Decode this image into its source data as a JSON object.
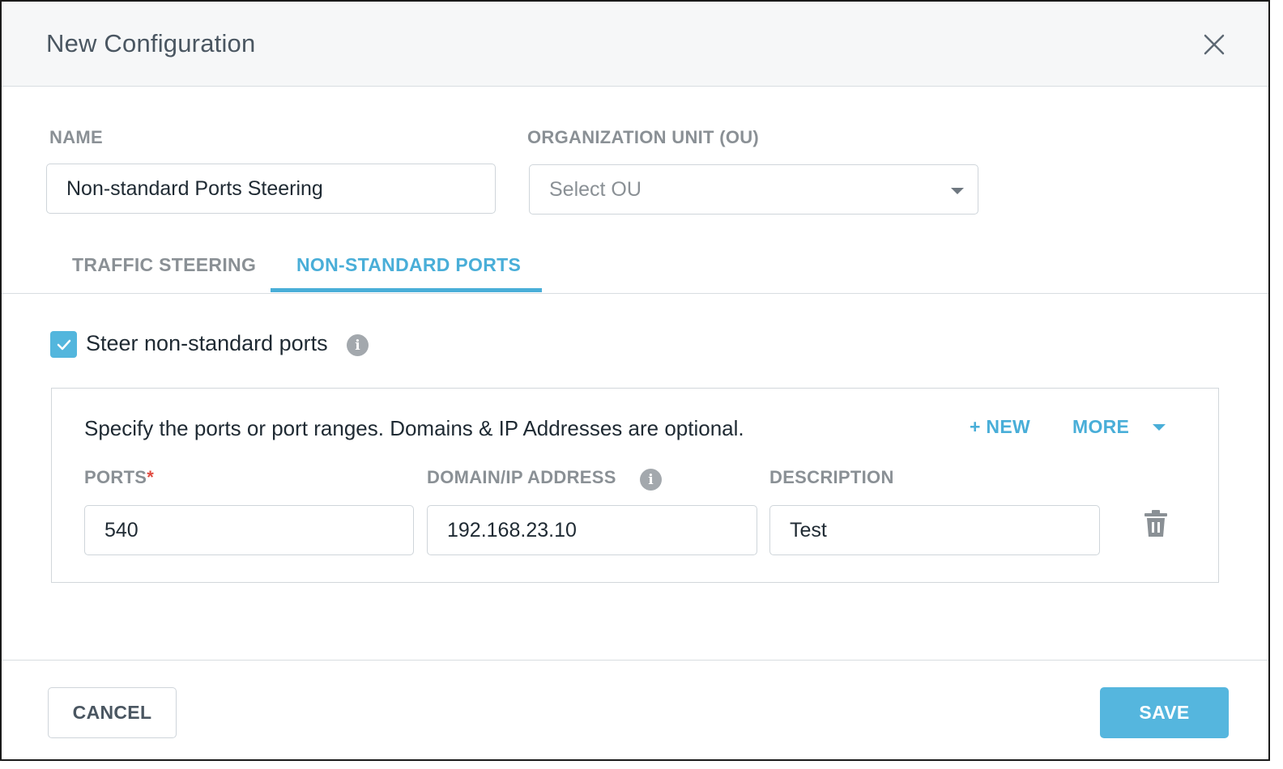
{
  "dialog": {
    "title": "New Configuration",
    "close_icon": "close-icon"
  },
  "form": {
    "name_label": "NAME",
    "name_value": "Non-standard Ports Steering",
    "ou_label": "ORGANIZATION UNIT (OU)",
    "ou_placeholder": "Select OU"
  },
  "tabs": [
    {
      "label": "TRAFFIC STEERING",
      "active": false
    },
    {
      "label": "NON-STANDARD PORTS",
      "active": true
    }
  ],
  "steer": {
    "checked": true,
    "label": "Steer non-standard ports",
    "info_icon": "info-icon"
  },
  "ports_panel": {
    "description": "Specify the ports or port ranges. Domains & IP Addresses are optional.",
    "new_label": "+ NEW",
    "more_label": "MORE",
    "columns": {
      "ports": "PORTS",
      "required_mark": "*",
      "domain": "DOMAIN/IP ADDRESS",
      "description": "DESCRIPTION"
    },
    "rows": [
      {
        "ports": "540",
        "domain": "192.168.23.10",
        "description": "Test"
      }
    ],
    "delete_icon": "trash-icon"
  },
  "footer": {
    "cancel_label": "CANCEL",
    "save_label": "SAVE"
  },
  "colors": {
    "accent": "#49aed8",
    "save_button": "#55b6de",
    "required": "#e04a3f"
  }
}
